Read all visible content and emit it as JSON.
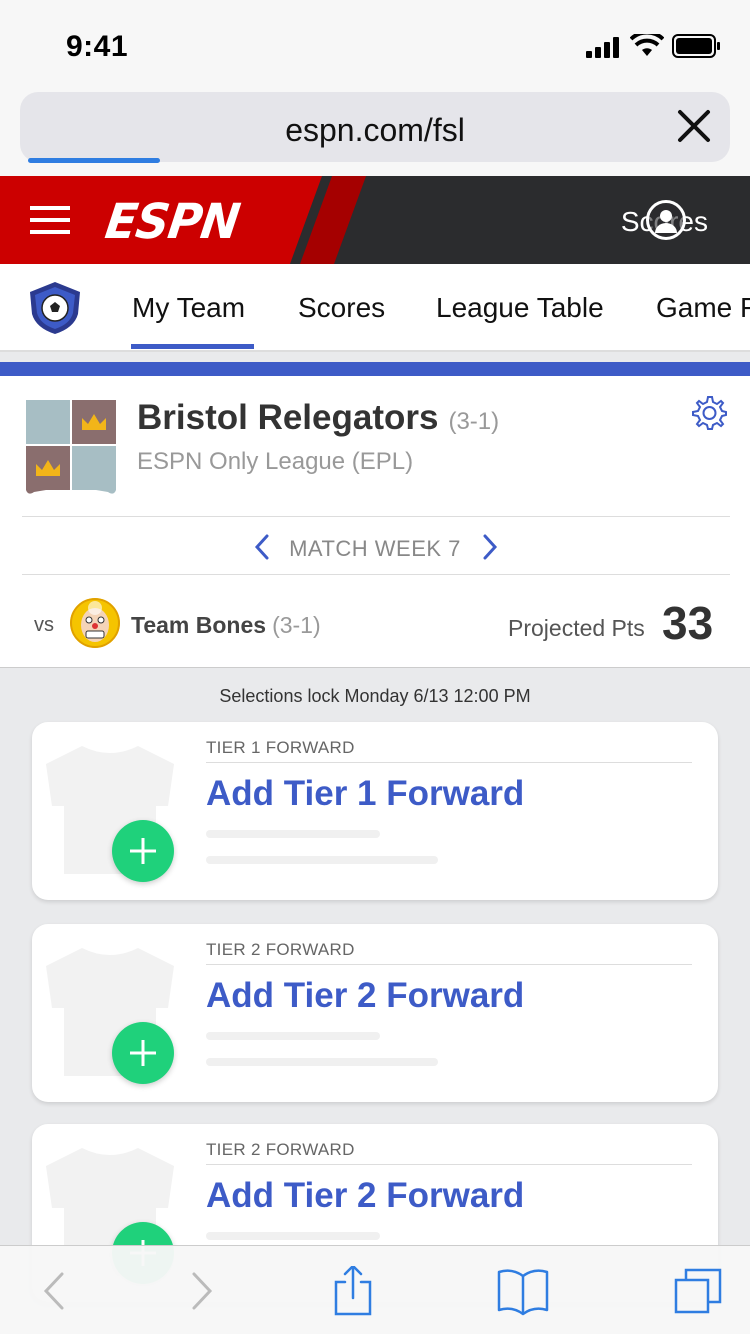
{
  "status_bar": {
    "time": "9:41"
  },
  "browser": {
    "url": "espn.com/fsl",
    "load_progress": 0.19
  },
  "espn_header": {
    "logo_text": "ESPN",
    "scores_link": "Scores"
  },
  "nav": {
    "tabs": [
      {
        "label": "My Team",
        "active": true
      },
      {
        "label": "Scores",
        "active": false
      },
      {
        "label": "League Table",
        "active": false
      },
      {
        "label": "Game F",
        "active": false
      }
    ]
  },
  "team": {
    "name": "Bristol Relegators",
    "record": "(3-1)",
    "league": "ESPN Only League (EPL)",
    "match_week": "MATCH WEEK 7",
    "vs_label": "vs",
    "opponent_name": "Team Bones",
    "opponent_record": "(3-1)",
    "projected_label": "Projected Pts",
    "projected_value": "33"
  },
  "lock_message": "Selections lock Monday 6/13 12:00 PM",
  "slots": [
    {
      "tier_label": "TIER 1 FORWARD",
      "action": "Add Tier 1 Forward"
    },
    {
      "tier_label": "TIER 2 FORWARD",
      "action": "Add Tier 2 Forward"
    },
    {
      "tier_label": "TIER 2 FORWARD",
      "action": "Add Tier 2 Forward"
    }
  ],
  "colors": {
    "espn_red": "#cc0000",
    "accent_blue": "#3d5bc7",
    "add_green": "#1fd17b"
  },
  "icons": [
    "signal-icon",
    "wifi-icon",
    "battery-icon",
    "close-icon",
    "hamburger-icon",
    "user-icon",
    "league-badge-icon",
    "gear-icon",
    "chevron-left-icon",
    "chevron-right-icon",
    "jersey-icon",
    "plus-icon",
    "back-icon",
    "forward-icon",
    "share-icon",
    "bookmarks-icon",
    "tabs-icon"
  ]
}
